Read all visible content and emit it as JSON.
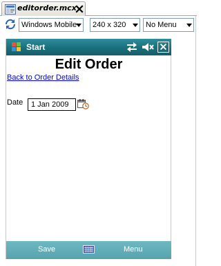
{
  "editor_tab": {
    "label": "editorder.mcx"
  },
  "toolbar": {
    "platform_selected": "Windows Mobile",
    "screen_size_selected": "240 x 320",
    "menu_selected": "No Menu"
  },
  "device": {
    "titlebar": {
      "start_label": "Start"
    },
    "content": {
      "heading": "Edit Order",
      "back_link": "Back to Order Details",
      "date_label": "Date",
      "date_value": "1 Jan 2009"
    },
    "softkeys": {
      "left": "Save",
      "right": "Menu"
    }
  },
  "colors": {
    "titlebar": "#1a6f7c",
    "softbar": "#5fabb6",
    "link": "#0000ee"
  },
  "icons": [
    "file-icon",
    "close-icon",
    "refresh-icon",
    "chevron-down-icon",
    "windows-flag-icon",
    "connectivity-icon",
    "speaker-muted-icon",
    "close-box-icon",
    "calendar-icon",
    "keyboard-icon"
  ]
}
